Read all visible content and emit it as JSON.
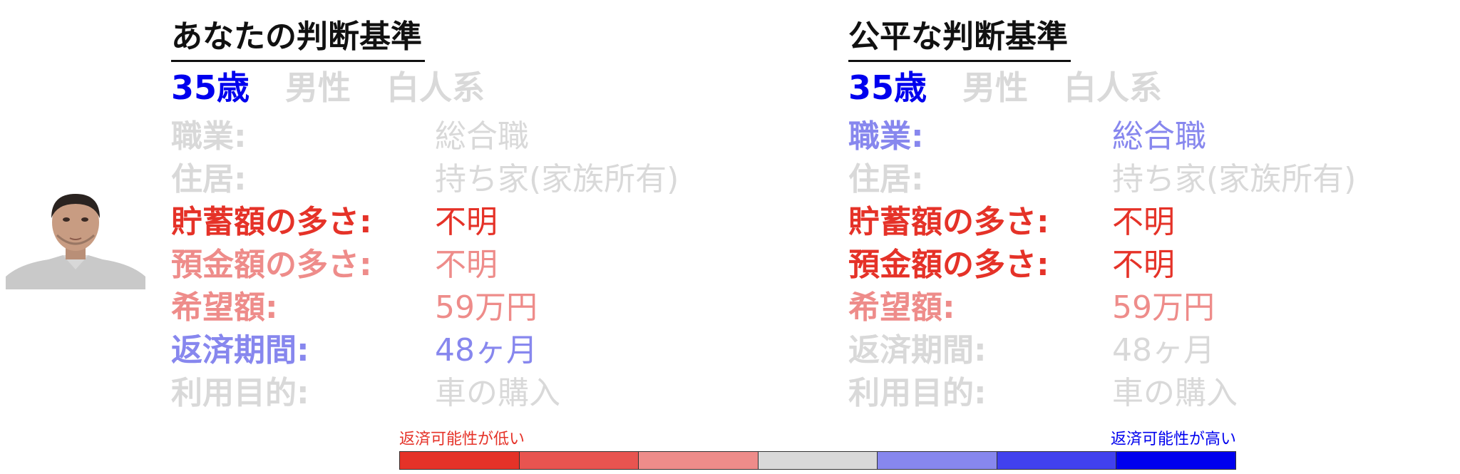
{
  "colors": {
    "red": "#e53228",
    "mid_red": "#e85450",
    "light_red": "#ee8c8a",
    "neutral": "#d9d9d9",
    "light_blue": "#8787ee",
    "mid_blue": "#4141ee",
    "blue": "#0000ee",
    "text_dark": "#111111"
  },
  "panels": [
    {
      "title": "あなたの判断基準",
      "demographics": [
        {
          "text": "35歳",
          "color": "#0000ee"
        },
        {
          "text": "男性",
          "color": "#d9d9d9"
        },
        {
          "text": "白人系",
          "color": "#d9d9d9"
        }
      ],
      "rows": [
        {
          "label": "職業:",
          "value": "総合職",
          "color": "#d9d9d9"
        },
        {
          "label": "住居:",
          "value": "持ち家(家族所有)",
          "color": "#d9d9d9"
        },
        {
          "label": "貯蓄額の多さ:",
          "value": "不明",
          "color": "#e53228"
        },
        {
          "label": "預金額の多さ:",
          "value": "不明",
          "color": "#ee8c8a"
        },
        {
          "label": "希望額:",
          "value": "59万円",
          "color": "#ee8c8a"
        },
        {
          "label": "返済期間:",
          "value": "48ヶ月",
          "color": "#8787ee"
        },
        {
          "label": "利用目的:",
          "value": "車の購入",
          "color": "#d9d9d9"
        }
      ]
    },
    {
      "title": "公平な判断基準",
      "demographics": [
        {
          "text": "35歳",
          "color": "#0000ee"
        },
        {
          "text": "男性",
          "color": "#d9d9d9"
        },
        {
          "text": "白人系",
          "color": "#d9d9d9"
        }
      ],
      "rows": [
        {
          "label": "職業:",
          "value": "総合職",
          "color": "#8787ee"
        },
        {
          "label": "住居:",
          "value": "持ち家(家族所有)",
          "color": "#d9d9d9"
        },
        {
          "label": "貯蓄額の多さ:",
          "value": "不明",
          "color": "#e53228"
        },
        {
          "label": "預金額の多さ:",
          "value": "不明",
          "color": "#e53228"
        },
        {
          "label": "希望額:",
          "value": "59万円",
          "color": "#ee8c8a"
        },
        {
          "label": "返済期間:",
          "value": "48ヶ月",
          "color": "#d9d9d9"
        },
        {
          "label": "利用目的:",
          "value": "車の購入",
          "color": "#d9d9d9"
        }
      ]
    }
  ],
  "legend": {
    "low_label": "返済可能性が低い",
    "high_label": "返済可能性が高い",
    "low_color": "#e53228",
    "high_color": "#0000ee",
    "segments": [
      "#e53228",
      "#e85450",
      "#ee8c8a",
      "#d9d9d9",
      "#8787ee",
      "#4141ee",
      "#0000ee"
    ]
  }
}
